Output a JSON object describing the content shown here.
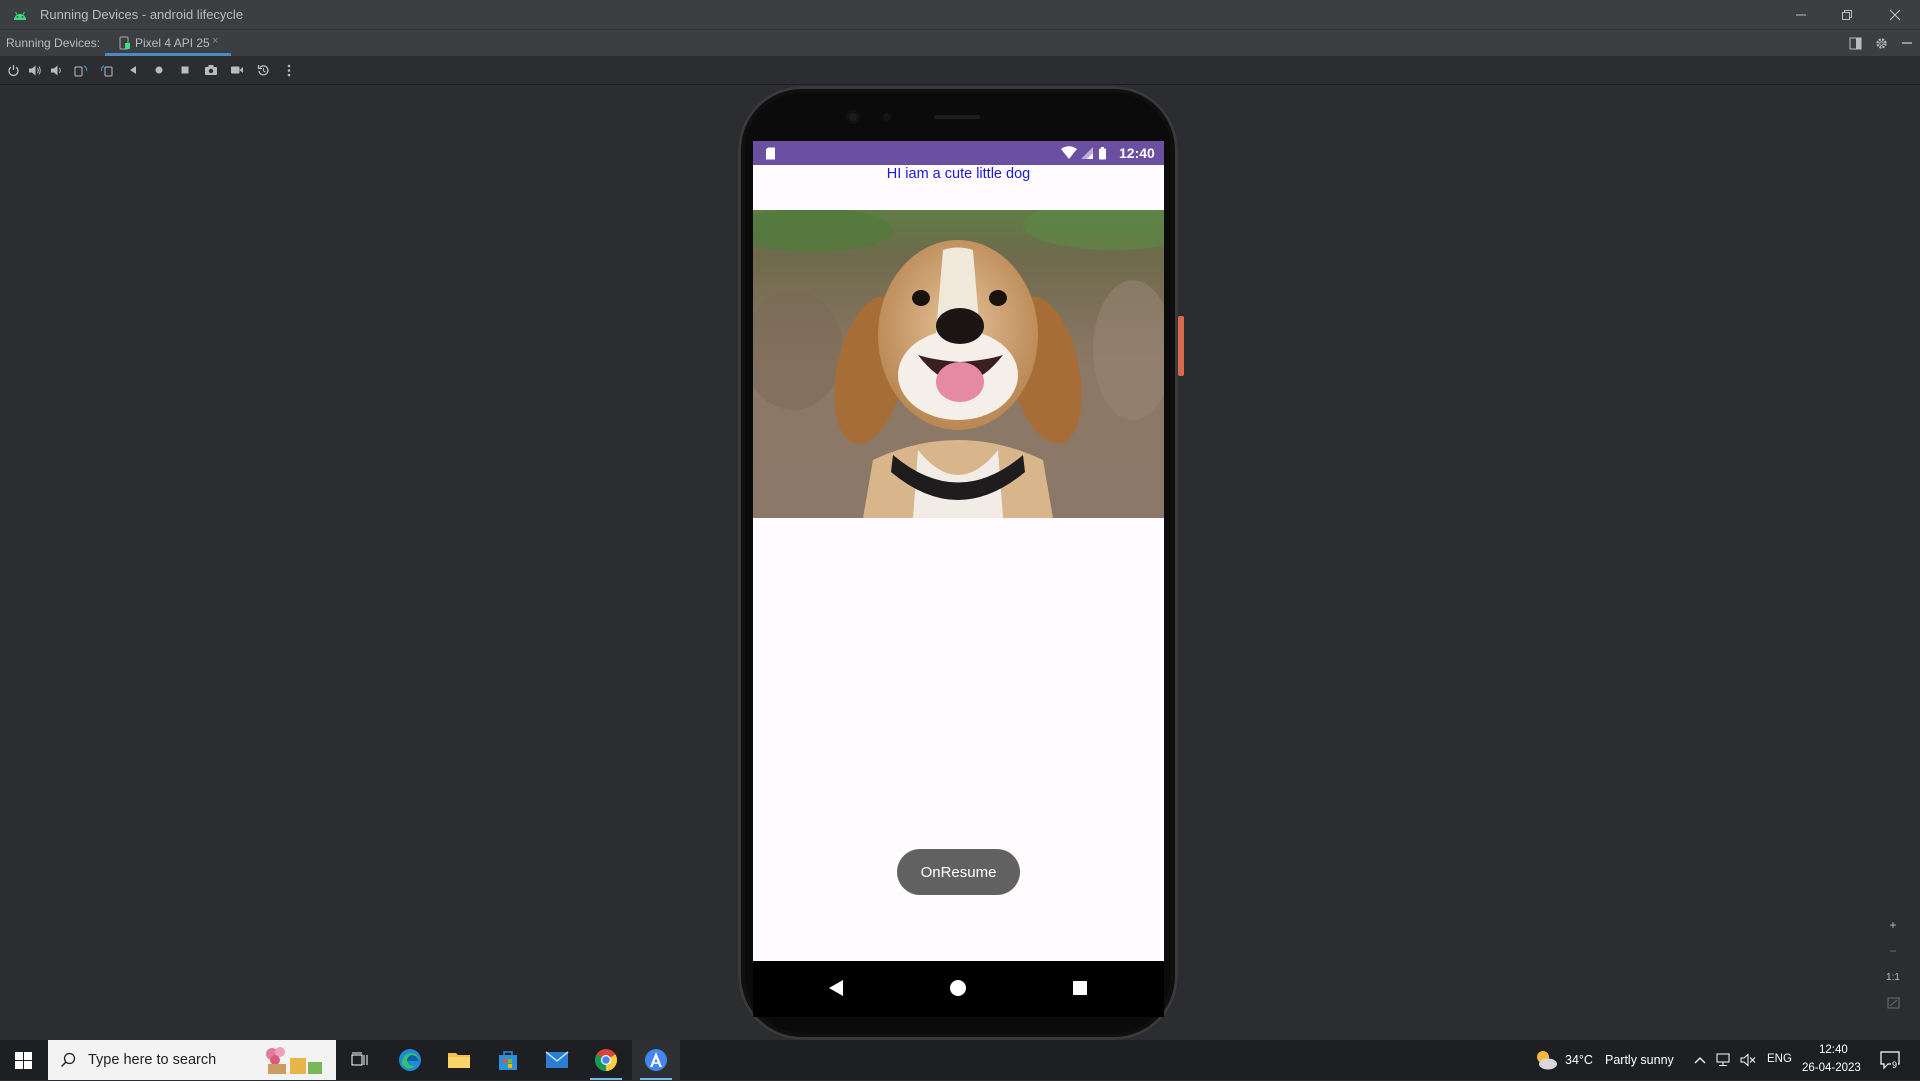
{
  "window": {
    "title": "Running Devices - android lifecycle"
  },
  "tabs": {
    "label": "Running Devices:",
    "active_tab": "Pixel 4 API 25",
    "close_glyph": "×"
  },
  "toolbar": {
    "icons": [
      "power-icon",
      "volume-up-icon",
      "volume-down-icon",
      "rotate-left-icon",
      "rotate-right-icon",
      "back-icon",
      "home-icon",
      "overview-icon",
      "screenshot-icon",
      "screen-record-icon",
      "reset-icon",
      "more-icon"
    ]
  },
  "device": {
    "status_time": "12:40",
    "greeting": "HI iam a cute little dog",
    "toast": "OnResume",
    "status_bar_color": "#6b4fa0"
  },
  "zoom": {
    "zoom_in": "+",
    "zoom_out": "−",
    "actual_size": "1:1"
  },
  "taskbar": {
    "search_placeholder": "Type here to search",
    "weather_temp": "34°C",
    "weather_desc": "Partly sunny",
    "language": "ENG",
    "clock_time": "12:40",
    "clock_date": "26-04-2023",
    "notification_count": "9"
  }
}
